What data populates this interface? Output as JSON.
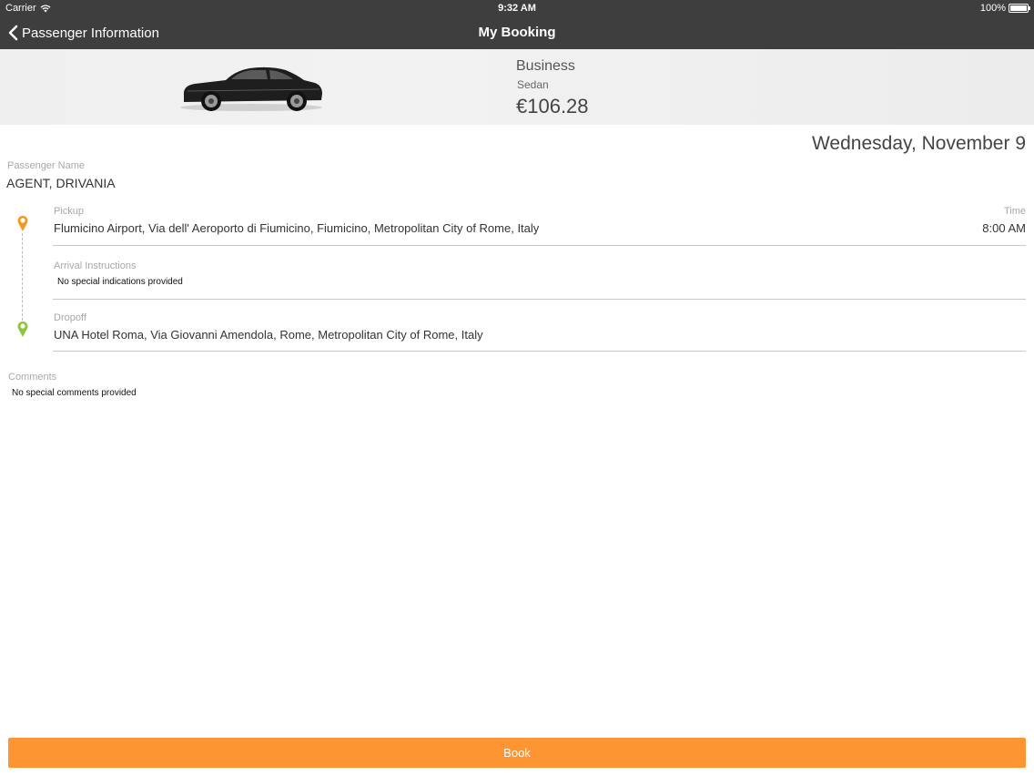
{
  "status_bar": {
    "carrier": "Carrier",
    "time": "9:32 AM",
    "battery": "100%"
  },
  "nav": {
    "back_label": "Passenger Information",
    "title": "My Booking"
  },
  "vehicle": {
    "class": "Business",
    "type": "Sedan",
    "price": "€106.28"
  },
  "date": "Wednesday, November 9",
  "passenger": {
    "label": "Passenger Name",
    "name": "AGENT, DRIVANIA"
  },
  "pickup": {
    "label": "Pickup",
    "address": "Flumicino Airport, Via dell' Aeroporto di Fiumicino, Fiumicino, Metropolitan City of Rome, Italy",
    "time_label": "Time",
    "time": "8:00 AM"
  },
  "arrival": {
    "label": "Arrival Instructions",
    "text": "No special indications provided"
  },
  "dropoff": {
    "label": "Dropoff",
    "address": "UNA Hotel Roma, Via Giovanni Amendola, Rome, Metropolitan City of Rome, Italy"
  },
  "comments": {
    "label": "Comments",
    "text": "No special comments provided"
  },
  "book_button": {
    "label": "Book"
  },
  "colors": {
    "accent": "#fd9532",
    "pickup_pin": "#f39a1e",
    "dropoff_pin": "#8cc63f",
    "bar": "#3e3e3e"
  }
}
